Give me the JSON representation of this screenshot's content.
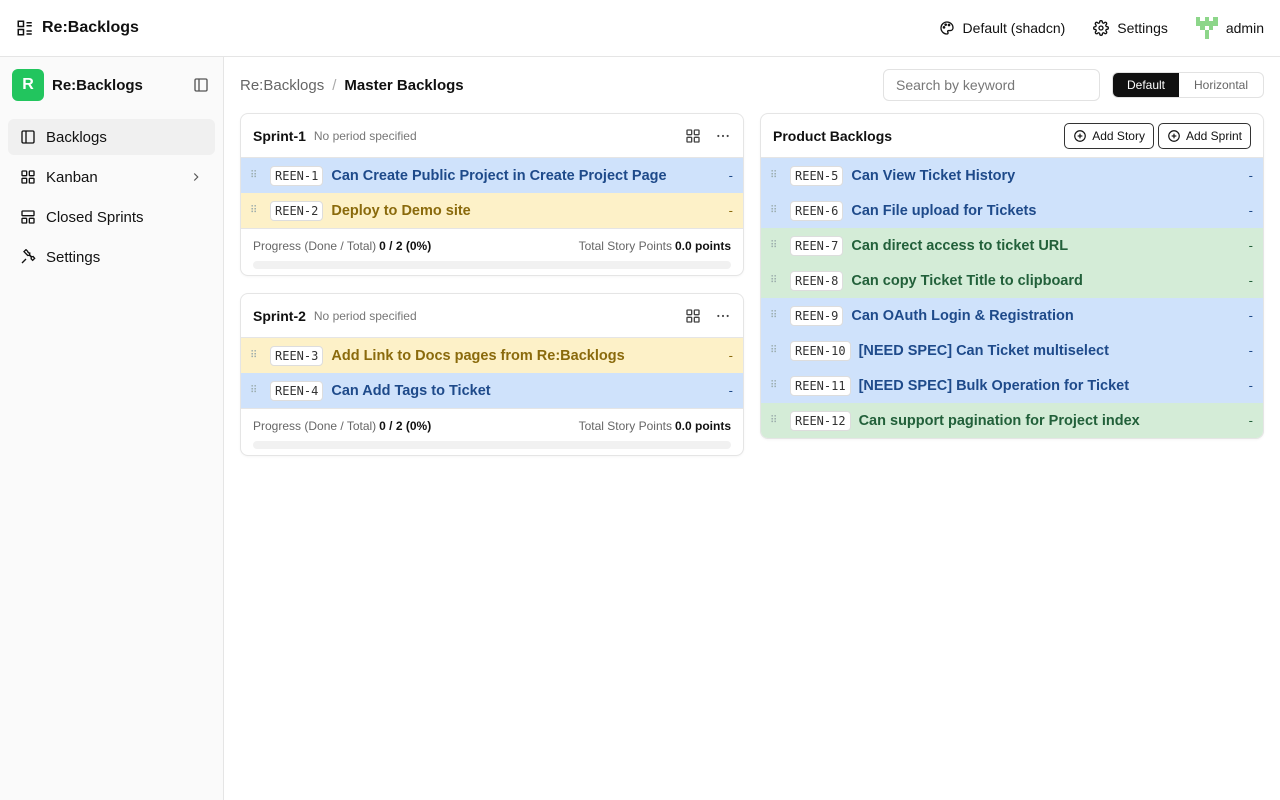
{
  "header": {
    "app_name": "Re:Backlogs",
    "theme_label": "Default (shadcn)",
    "settings_label": "Settings",
    "user_label": "admin"
  },
  "sidebar": {
    "title": "Re:Backlogs",
    "logo_letter": "R",
    "items": [
      {
        "label": "Backlogs",
        "icon": "panel-icon"
      },
      {
        "label": "Kanban",
        "icon": "kanban-icon"
      },
      {
        "label": "Closed Sprints",
        "icon": "archive-icon"
      },
      {
        "label": "Settings",
        "icon": "wrench-icon"
      }
    ]
  },
  "breadcrumb": {
    "root": "Re:Backlogs",
    "separator": "/",
    "current": "Master Backlogs"
  },
  "search": {
    "placeholder": "Search by keyword"
  },
  "view_toggle": {
    "default_label": "Default",
    "horizontal_label": "Horizontal",
    "selected": "Default"
  },
  "sprints": [
    {
      "name": "Sprint-1",
      "period": "No period specified",
      "tickets": [
        {
          "key": "REEN-1",
          "title": "Can Create Public Project in Create Project Page",
          "points": "-",
          "color": "blue"
        },
        {
          "key": "REEN-2",
          "title": "Deploy to Demo site",
          "points": "-",
          "color": "yellow"
        }
      ],
      "progress_label": "Progress (Done / Total)",
      "progress_value": "0 / 2 (0%)",
      "progress_fraction": 0,
      "points_label": "Total Story Points",
      "points_value": "0.0 points"
    },
    {
      "name": "Sprint-2",
      "period": "No period specified",
      "tickets": [
        {
          "key": "REEN-3",
          "title": "Add Link to Docs pages from Re:Backlogs",
          "points": "-",
          "color": "yellow"
        },
        {
          "key": "REEN-4",
          "title": "Can Add Tags to Ticket",
          "points": "-",
          "color": "blue"
        }
      ],
      "progress_label": "Progress (Done / Total)",
      "progress_value": "0 / 2 (0%)",
      "progress_fraction": 0,
      "points_label": "Total Story Points",
      "points_value": "0.0 points"
    }
  ],
  "product_backlog": {
    "title": "Product Backlogs",
    "add_story_label": "Add Story",
    "add_sprint_label": "Add Sprint",
    "tickets": [
      {
        "key": "REEN-5",
        "title": "Can View Ticket History",
        "points": "-",
        "color": "blue"
      },
      {
        "key": "REEN-6",
        "title": "Can File upload for Tickets",
        "points": "-",
        "color": "blue"
      },
      {
        "key": "REEN-7",
        "title": "Can direct access to ticket URL",
        "points": "-",
        "color": "green"
      },
      {
        "key": "REEN-8",
        "title": "Can copy Ticket Title to clipboard",
        "points": "-",
        "color": "green"
      },
      {
        "key": "REEN-9",
        "title": "Can OAuth Login & Registration",
        "points": "-",
        "color": "blue"
      },
      {
        "key": "REEN-10",
        "title": "[NEED SPEC] Can Ticket multiselect",
        "points": "-",
        "color": "blue"
      },
      {
        "key": "REEN-11",
        "title": "[NEED SPEC] Bulk Operation for Ticket",
        "points": "-",
        "color": "blue"
      },
      {
        "key": "REEN-12",
        "title": "Can support pagination for Project index",
        "points": "-",
        "color": "green"
      }
    ]
  },
  "colors": {
    "accent": "#22c55e",
    "blue_row": "#cfe2fb",
    "yellow_row": "#fdf1c8",
    "green_row": "#d4ecd7"
  }
}
